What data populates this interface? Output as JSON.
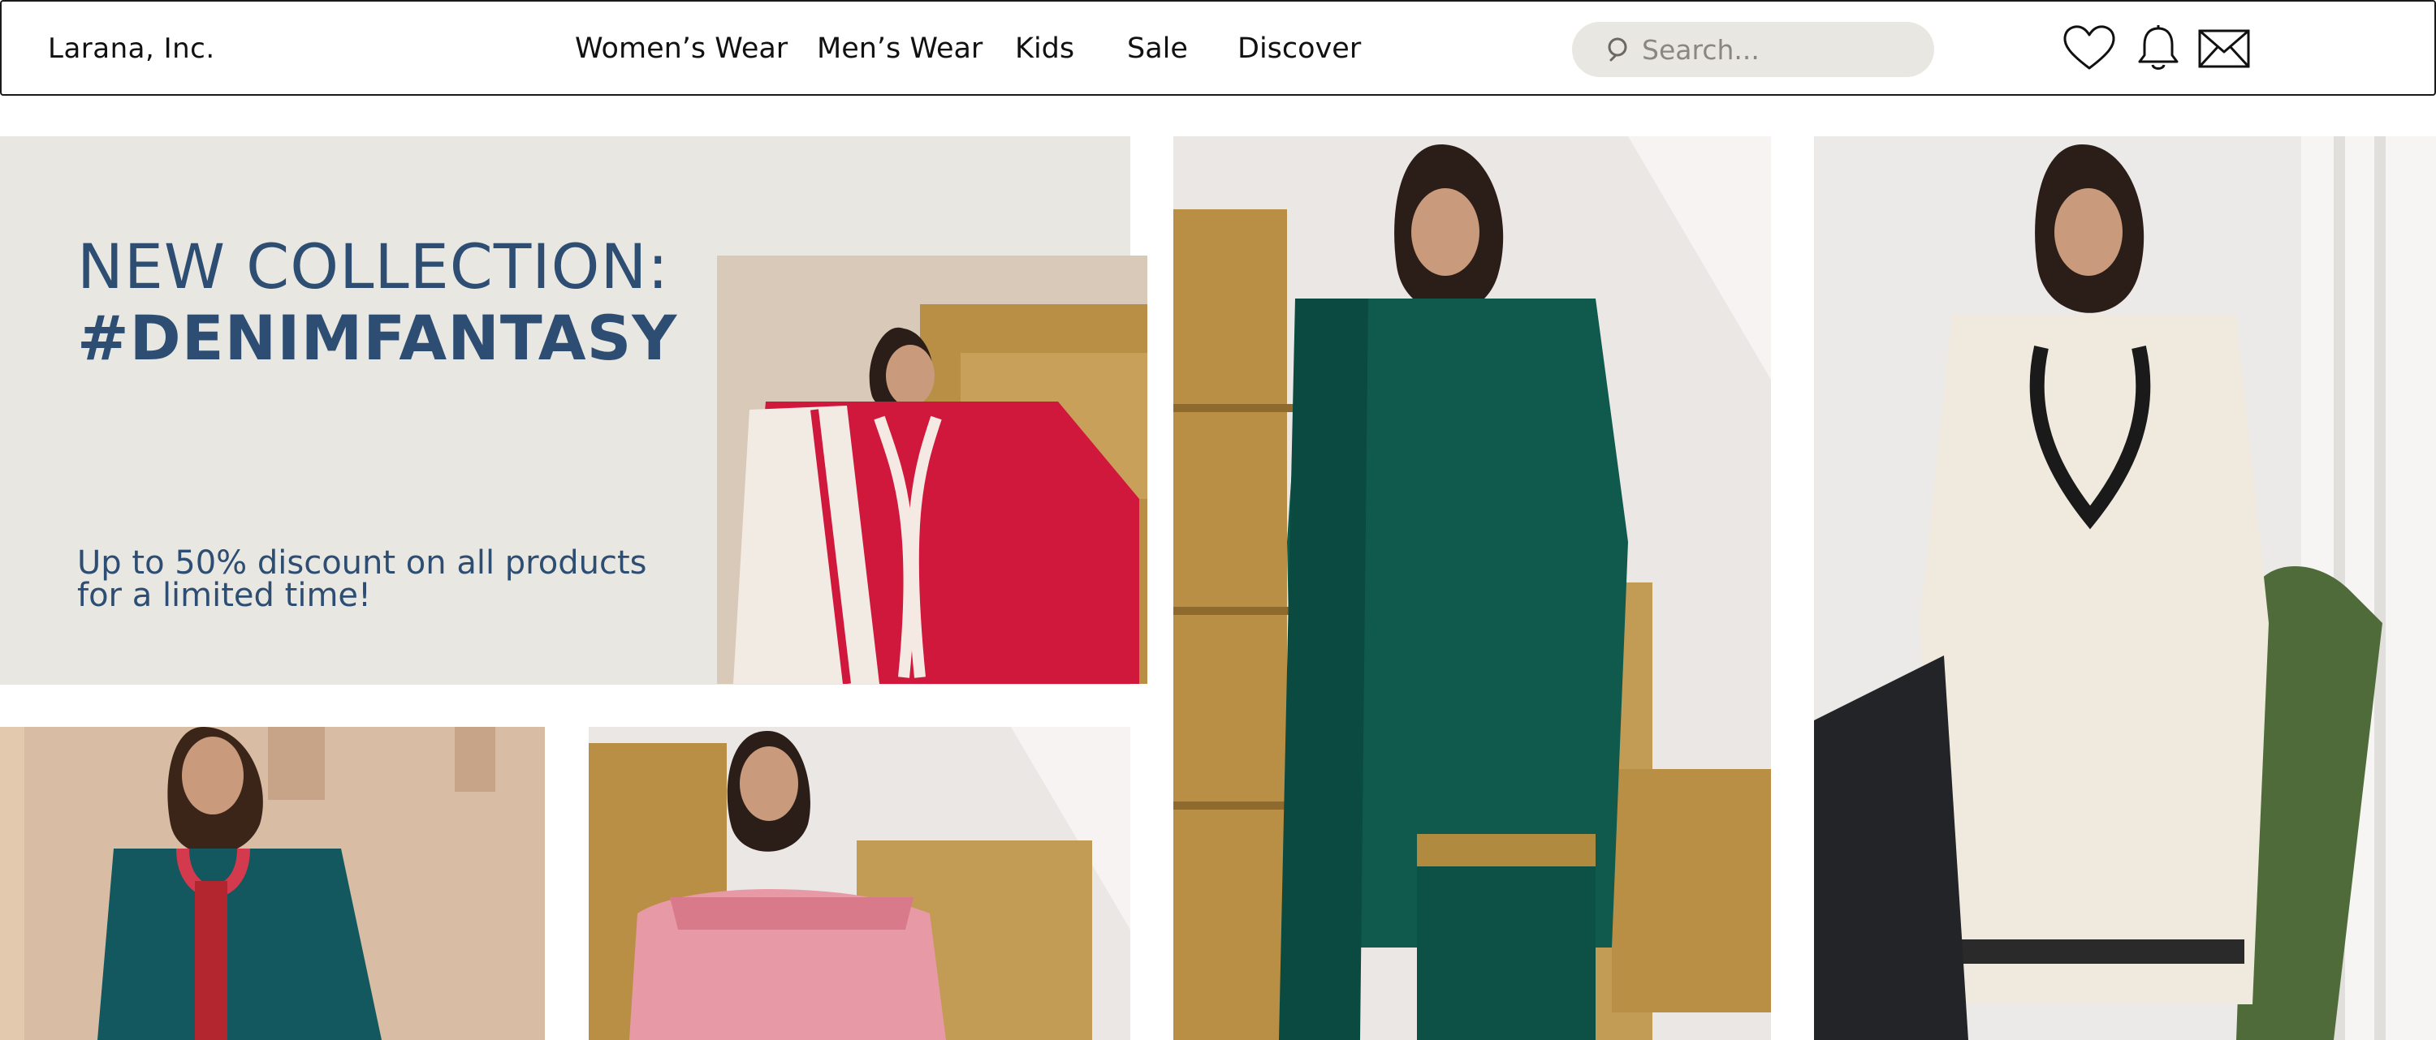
{
  "header": {
    "brand": "Larana, Inc.",
    "nav": [
      "Women’s Wear",
      "Men’s Wear",
      "Kids",
      "Sale",
      "Discover"
    ],
    "search_placeholder": "Search...",
    "icons": [
      "heart-icon",
      "bell-icon",
      "mail-icon"
    ]
  },
  "hero": {
    "line1": "NEW COLLECTION:",
    "line2": "#DENIMFANTASY",
    "subtitle": "Up to 50% discount on all products for a limited time!"
  },
  "colors": {
    "accent": "#2d4e72",
    "panel": "#e9e7e2",
    "red_outfit": "#d0173c",
    "green_outfit": "#0f5a4d",
    "ivory_outfit": "#efe9de",
    "teal_outfit": "#12585e",
    "pink_outfit": "#e79aa6",
    "hay": "#b88f45"
  },
  "tiles": [
    {
      "name": "product-red-embroidered-tile"
    },
    {
      "name": "product-green-kurta-tile"
    },
    {
      "name": "product-ivory-embroidered-tile"
    },
    {
      "name": "product-teal-kurta-tile"
    },
    {
      "name": "product-pink-suit-tile"
    }
  ]
}
